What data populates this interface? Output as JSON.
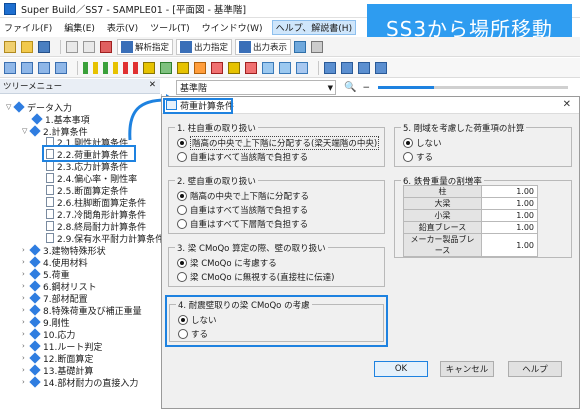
{
  "window": {
    "title": "Super Build／SS7 - SAMPLE01 - [平面図 - 基準階]"
  },
  "badge": {
    "text": "SS3から場所移動"
  },
  "menu": [
    "ファイル(F)",
    "編集(E)",
    "表示(V)",
    "ツール(T)",
    "ウインドウ(W)",
    "ヘルプ、解説書(H)"
  ],
  "toolbar": {
    "analysis_btn": "解析指定",
    "output_spec_btn": "出力指定",
    "output_view_btn": "出力表示",
    "floor_select": "基準階"
  },
  "colors": {
    "accent": "#1e82e0",
    "badge": "#2e9cf0"
  },
  "tree": {
    "header": "ツリーメニュー",
    "nodes": [
      {
        "label": "データ入力",
        "expanded": true
      },
      {
        "label": "1.基本事項"
      },
      {
        "label": "2.計算条件",
        "expanded": true
      },
      {
        "label": "2.1.剛性計算条件"
      },
      {
        "label": "2.2.荷重計算条件",
        "selected": true
      },
      {
        "label": "2.3.応力計算条件"
      },
      {
        "label": "2.4.偏心率・剛性率"
      },
      {
        "label": "2.5.断面算定条件"
      },
      {
        "label": "2.6.柱脚断面算定条件"
      },
      {
        "label": "2.7.冷間角形計算条件"
      },
      {
        "label": "2.8.終局耐力計算条件"
      },
      {
        "label": "2.9.保有水平耐力計算条件"
      },
      {
        "label": "3.建物特殊形状"
      },
      {
        "label": "4.使用材料"
      },
      {
        "label": "5.荷重"
      },
      {
        "label": "6.鋼材リスト"
      },
      {
        "label": "7.部材配置"
      },
      {
        "label": "8.特殊荷重及び補正重量"
      },
      {
        "label": "9.剛性"
      },
      {
        "label": "10.応力"
      },
      {
        "label": "11.ルート判定"
      },
      {
        "label": "12.断面算定"
      },
      {
        "label": "13.基礎計算"
      },
      {
        "label": "14.部材耐力の直接入力"
      }
    ]
  },
  "dialog": {
    "title": "荷重計算条件",
    "g1": {
      "title": "1. 柱自重の取り扱い",
      "opt1": "階高の中央で上下階に分配する(梁天端階の中央)",
      "opt2": "自重はすべて当該階で負担する"
    },
    "g2": {
      "title": "2. 壁自重の取り扱い",
      "opt1": "階高の中央で上下階に分配する",
      "opt2": "自重はすべて当該階で負担する",
      "opt3": "自重はすべて下層階で負担する"
    },
    "g3": {
      "title": "3. 梁 CMoQo 算定の際、壁の取り扱い",
      "opt1": "梁 CMoQo に考慮する",
      "opt2": "梁 CMoQo に無視する(直接柱に伝達)"
    },
    "g4": {
      "title": "4. 耐震壁取りの梁 CMoQo の考慮",
      "opt1": "しない",
      "opt2": "する"
    },
    "g5": {
      "title": "5. 剛域を考慮した荷重項の計算",
      "opt1": "しない",
      "opt2": "する"
    },
    "g6": {
      "title": "6. 鉄骨重量の割増率",
      "rows": [
        {
          "name": "柱",
          "value": "1.00"
        },
        {
          "name": "大梁",
          "value": "1.00"
        },
        {
          "name": "小梁",
          "value": "1.00"
        },
        {
          "name": "鉛直ブレース",
          "value": "1.00"
        },
        {
          "name": "メーカー製品ブレース",
          "value": "1.00"
        }
      ]
    },
    "buttons": {
      "ok": "OK",
      "cancel": "キャンセル",
      "help": "ヘルプ"
    }
  }
}
